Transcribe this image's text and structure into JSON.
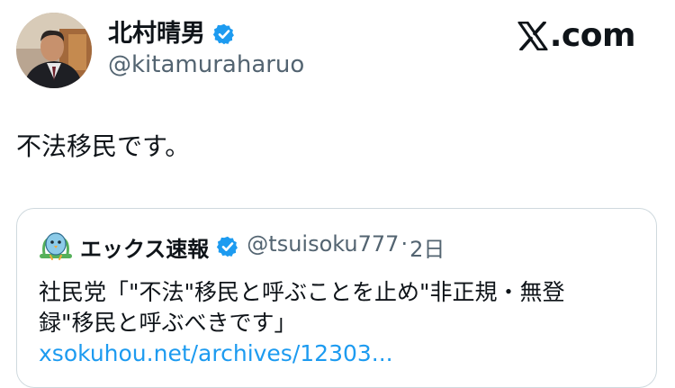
{
  "author": {
    "display_name": "北村晴男",
    "handle": "@kitamuraharuo",
    "verified_icon": "verified-badge-icon"
  },
  "brand": {
    "text": ".com",
    "logo_icon": "x-logo-icon"
  },
  "tweet": {
    "text": "不法移民です。"
  },
  "quoted": {
    "display_name": "エックス速報",
    "handle": "@tsuisoku777",
    "separator": "·",
    "time": "2日",
    "text": "社民党「\"不法\"移民と呼ぶことを止め\"非正規・無登録\"移民と呼ぶべきです」",
    "link": "xsokuhou.net/archives/12303..."
  },
  "colors": {
    "accent": "#1d9bf0",
    "secondary_text": "#536471",
    "border": "#cfd9de"
  }
}
